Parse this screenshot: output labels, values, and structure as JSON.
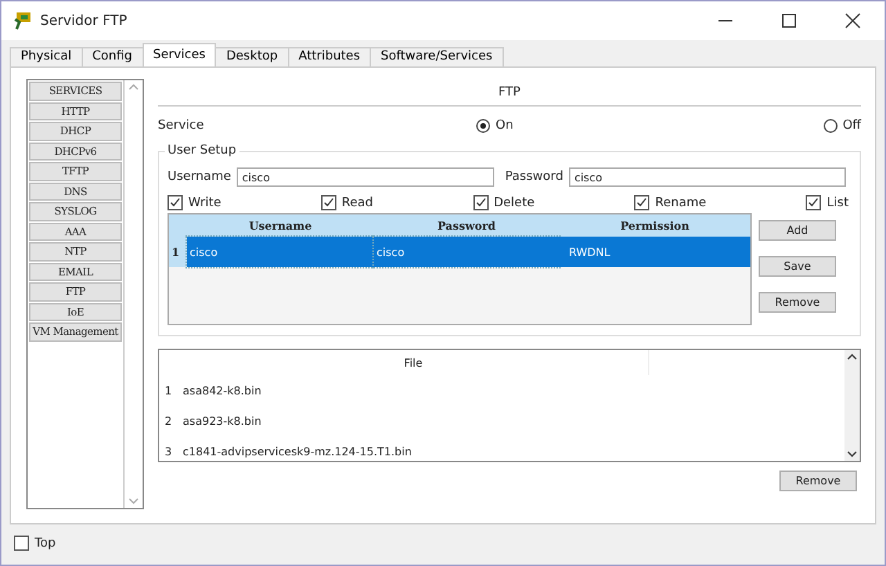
{
  "window": {
    "title": "Servidor FTP"
  },
  "tabs": [
    {
      "label": "Physical",
      "selected": false
    },
    {
      "label": "Config",
      "selected": false
    },
    {
      "label": "Services",
      "selected": true
    },
    {
      "label": "Desktop",
      "selected": false
    },
    {
      "label": "Attributes",
      "selected": false
    },
    {
      "label": "Software/Services",
      "selected": false
    }
  ],
  "sidebar": {
    "items": [
      {
        "label": "SERVICES",
        "selected": false
      },
      {
        "label": "HTTP",
        "selected": false
      },
      {
        "label": "DHCP",
        "selected": false
      },
      {
        "label": "DHCPv6",
        "selected": false
      },
      {
        "label": "TFTP",
        "selected": false
      },
      {
        "label": "DNS",
        "selected": false
      },
      {
        "label": "SYSLOG",
        "selected": false
      },
      {
        "label": "AAA",
        "selected": false
      },
      {
        "label": "NTP",
        "selected": false
      },
      {
        "label": "EMAIL",
        "selected": false
      },
      {
        "label": "FTP",
        "selected": false
      },
      {
        "label": "IoE",
        "selected": false
      },
      {
        "label": "VM Management",
        "selected": false
      }
    ]
  },
  "panel": {
    "title": "FTP",
    "service_label": "Service",
    "service_options": [
      {
        "label": "On",
        "selected": true
      },
      {
        "label": "Off",
        "selected": false
      }
    ]
  },
  "user_setup": {
    "title": "User Setup",
    "username_label": "Username",
    "username_value": "cisco",
    "password_label": "Password",
    "password_value": "cisco",
    "permissions": [
      {
        "label": "Write",
        "checked": true
      },
      {
        "label": "Read",
        "checked": true
      },
      {
        "label": "Delete",
        "checked": true
      },
      {
        "label": "Rename",
        "checked": true
      },
      {
        "label": "List",
        "checked": true
      }
    ],
    "table": {
      "columns": [
        "Username",
        "Password",
        "Permission"
      ],
      "rows": [
        {
          "index": "1",
          "cells": [
            "cisco",
            "cisco",
            "RWDNL"
          ],
          "selected": true
        }
      ]
    },
    "buttons": [
      "Add",
      "Save",
      "Remove"
    ]
  },
  "files": {
    "columns": [
      "File"
    ],
    "rows": [
      {
        "index": "1",
        "name": "asa842-k8.bin"
      },
      {
        "index": "2",
        "name": "asa923-k8.bin"
      },
      {
        "index": "3",
        "name": "c1841-advipservicesk9-mz.124-15.T1.bin"
      }
    ],
    "button": "Remove"
  },
  "footer": {
    "top_label": "Top",
    "top_checked": false
  }
}
